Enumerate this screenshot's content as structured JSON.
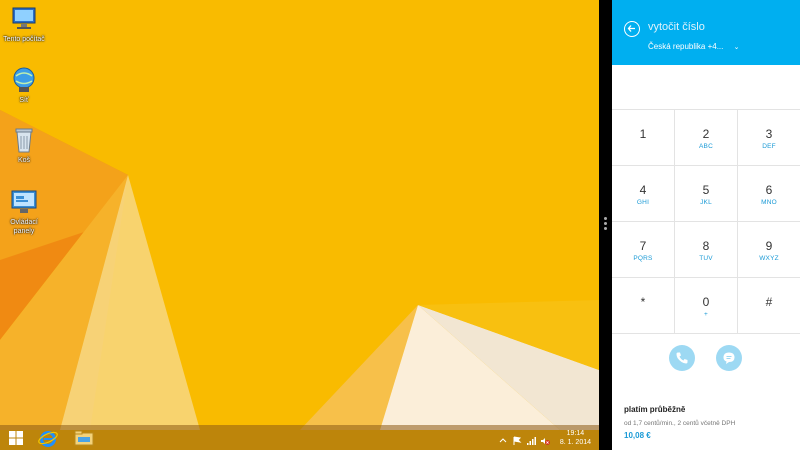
{
  "desktop": {
    "icons": [
      {
        "label": "Tento počítač",
        "icon": "computer-icon"
      },
      {
        "label": "Síť",
        "icon": "network-icon"
      },
      {
        "label": "Koš",
        "icon": "recycle-bin-icon"
      },
      {
        "label": "Ovládací panely",
        "icon": "control-panel-icon"
      }
    ]
  },
  "taskbar": {
    "buttons": [
      "start-icon",
      "internet-explorer-icon",
      "file-explorer-icon"
    ],
    "clock_time": "19:14",
    "clock_date": "8. 1. 2014"
  },
  "skype": {
    "title": "vytočit číslo",
    "country": "Česká republika +4...",
    "keys": [
      {
        "digit": "1",
        "letters": ""
      },
      {
        "digit": "2",
        "letters": "ABC"
      },
      {
        "digit": "3",
        "letters": "DEF"
      },
      {
        "digit": "4",
        "letters": "GHI"
      },
      {
        "digit": "5",
        "letters": "JKL"
      },
      {
        "digit": "6",
        "letters": "MNO"
      },
      {
        "digit": "7",
        "letters": "PQRS"
      },
      {
        "digit": "8",
        "letters": "TUV"
      },
      {
        "digit": "9",
        "letters": "WXYZ"
      },
      {
        "digit": "*",
        "letters": ""
      },
      {
        "digit": "0",
        "letters": "+"
      },
      {
        "digit": "#",
        "letters": ""
      }
    ],
    "rate_title": "platím průběžně",
    "rate_desc": "od 1,7 centů/min., 2 centů včetně DPH",
    "rate_price": "10,08 €",
    "colors": {
      "accent": "#00aff0",
      "button": "#9dd9f3"
    }
  }
}
